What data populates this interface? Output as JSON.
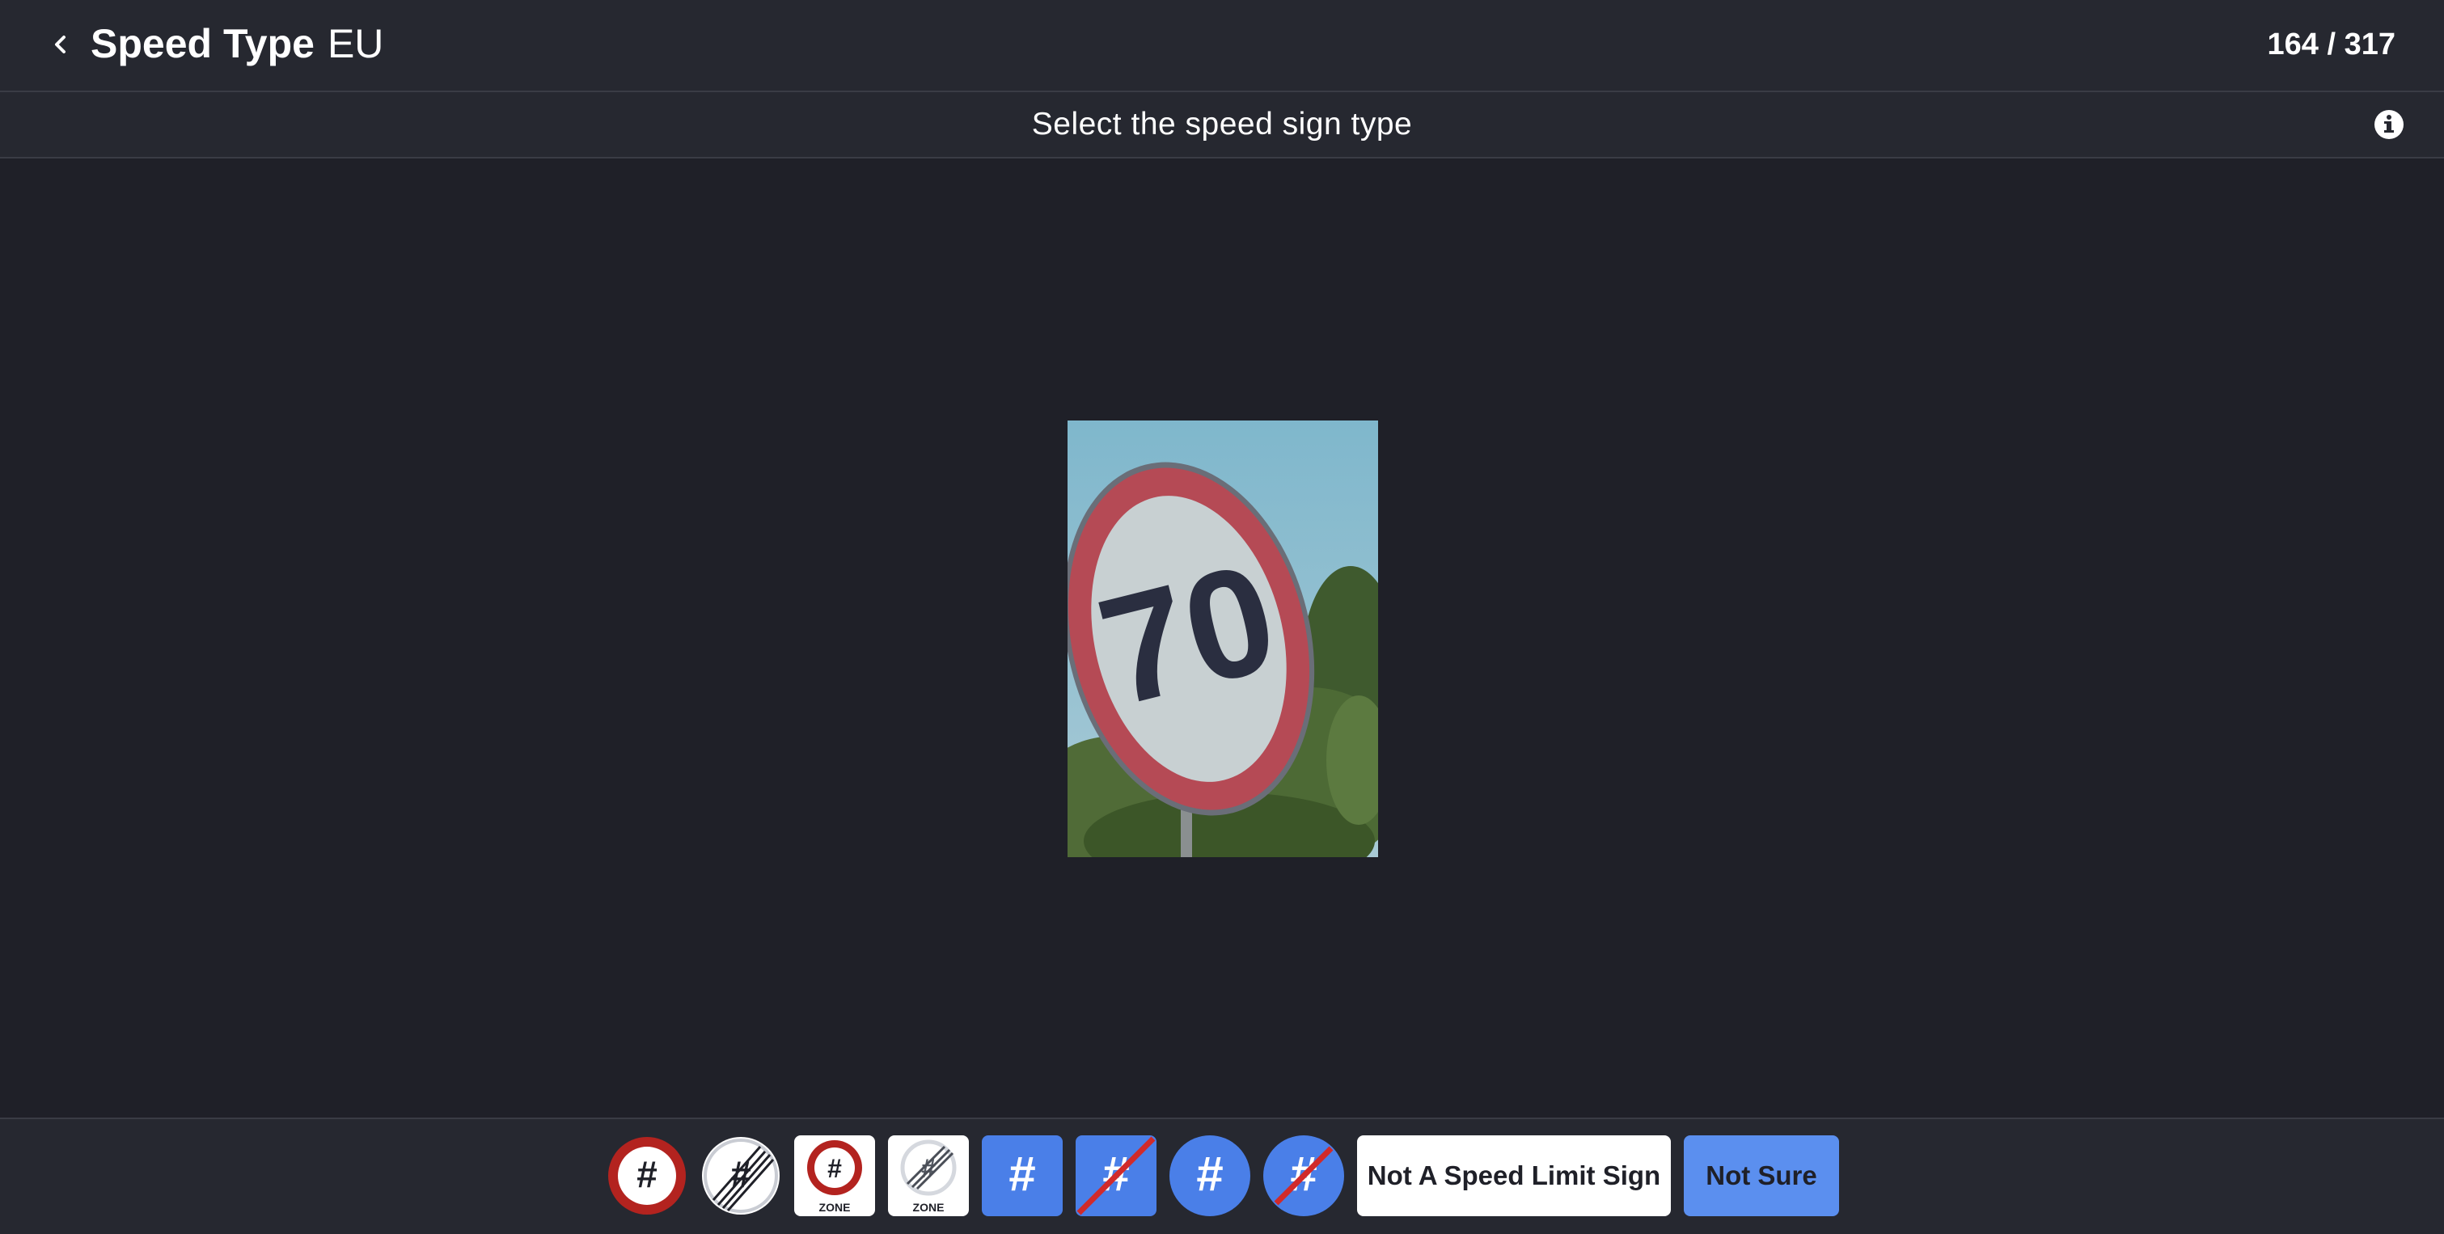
{
  "header": {
    "title": "Speed Type",
    "subtitle": "EU",
    "counter": "164 / 317"
  },
  "instruction": "Select the speed sign type",
  "image": {
    "sign_value": "70"
  },
  "options": [
    {
      "name": "speed-limit",
      "symbol": "#"
    },
    {
      "name": "end-speed-limit",
      "symbol": "#"
    },
    {
      "name": "speed-limit-zone",
      "symbol": "#",
      "caption": "ZONE"
    },
    {
      "name": "end-speed-limit-zone",
      "symbol": "#",
      "caption": "ZONE"
    },
    {
      "name": "advisory-speed",
      "symbol": "#"
    },
    {
      "name": "end-advisory-speed",
      "symbol": "#"
    },
    {
      "name": "minimum-speed",
      "symbol": "#"
    },
    {
      "name": "end-minimum-speed",
      "symbol": "#"
    }
  ],
  "buttons": {
    "not_speed_sign": "Not A Speed Limit Sign",
    "not_sure": "Not Sure"
  },
  "colors": {
    "background": "#1f2028",
    "bar": "#262830",
    "accent_blue": "#4a7fe8",
    "sign_red": "#b3231f",
    "not_sure_blue": "#5b8fef"
  }
}
